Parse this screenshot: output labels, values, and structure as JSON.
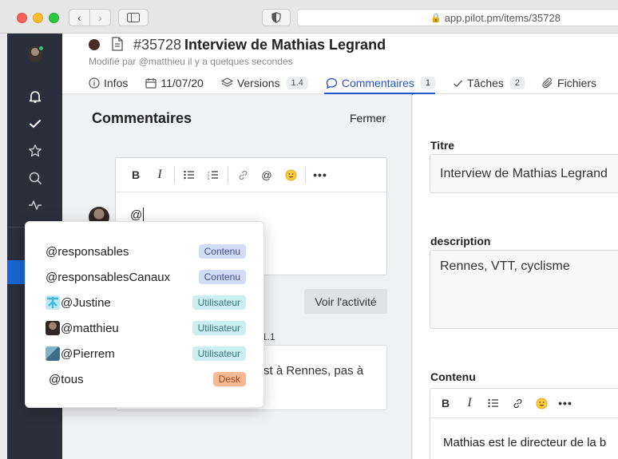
{
  "browser": {
    "url": "app.pilot.pm/items/35728"
  },
  "header": {
    "item_id": "#35728",
    "title": "Interview de Mathias Legrand",
    "modified": "Modifié par @matthieu il y a quelques secondes",
    "status_color": "#4a2f24",
    "tabs": [
      {
        "label": "Infos",
        "icon": "info-icon"
      },
      {
        "label": "11/07/20",
        "icon": "calendar-icon"
      },
      {
        "label": "Versions",
        "icon": "layers-icon",
        "count": "1.4"
      },
      {
        "label": "Commentaires",
        "icon": "comment-icon",
        "count": "1",
        "active": true
      },
      {
        "label": "Tâches",
        "icon": "check-icon",
        "count": "2"
      },
      {
        "label": "Fichiers",
        "icon": "paperclip-icon"
      }
    ]
  },
  "comments": {
    "title": "Commentaires",
    "close_label": "Fermer",
    "editor_text": "@",
    "activity_button": "Voir l'activité",
    "version_label": "1.1",
    "comment_text": "st à Rennes, pas à"
  },
  "mention": {
    "items": [
      {
        "label": "@responsables",
        "badge": "Contenu",
        "type": "contenu"
      },
      {
        "label": "@responsablesCanaux",
        "badge": "Contenu",
        "type": "contenu"
      },
      {
        "label": "@Justine",
        "badge": "Utilisateur",
        "type": "user",
        "avatar_color": "#3fb8d8"
      },
      {
        "label": "@matthieu",
        "badge": "Utilisateur",
        "type": "user",
        "avatar_color": "#3a322e"
      },
      {
        "label": "@Pierrem",
        "badge": "Utilisateur",
        "type": "user",
        "avatar_color": "#5a8fa8"
      },
      {
        "label": "@tous",
        "badge": "Desk",
        "type": "desk"
      }
    ]
  },
  "form": {
    "titre_label": "Titre",
    "titre_value": "Interview de Mathias Legrand",
    "description_label": "description",
    "description_value": "Rennes, VTT, cyclisme",
    "contenu_label": "Contenu",
    "contenu_text": "Mathias est le directeur de la b"
  },
  "colors": {
    "accent": "#1f55c9",
    "sidebar": "#2b2e3b"
  }
}
